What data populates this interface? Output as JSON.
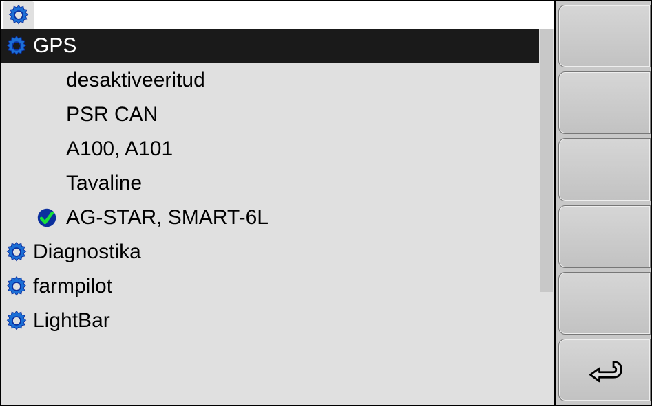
{
  "header": {
    "title": ""
  },
  "menu": {
    "items": [
      {
        "key": "gps",
        "label": "GPS",
        "has_gear": true,
        "selected": true
      },
      {
        "key": "diagnostika",
        "label": "Diagnostika",
        "has_gear": true,
        "selected": false
      },
      {
        "key": "farmpilot",
        "label": "farmpilot",
        "has_gear": true,
        "selected": false
      },
      {
        "key": "lightbar",
        "label": "LightBar",
        "has_gear": true,
        "selected": false
      }
    ]
  },
  "gps_options": [
    {
      "label": "desaktiveeritud",
      "checked": false
    },
    {
      "label": "PSR CAN",
      "checked": false
    },
    {
      "label": "A100, A101",
      "checked": false
    },
    {
      "label": "Tavaline",
      "checked": false
    },
    {
      "label": "AG-STAR, SMART-6L",
      "checked": true
    }
  ],
  "sidebar": {
    "buttons": [
      {
        "name": "side-btn-1",
        "icon": null
      },
      {
        "name": "side-btn-2",
        "icon": null
      },
      {
        "name": "side-btn-3",
        "icon": null
      },
      {
        "name": "side-btn-4",
        "icon": null
      },
      {
        "name": "side-btn-5",
        "icon": null
      },
      {
        "name": "side-btn-back",
        "icon": "back"
      }
    ]
  },
  "icons": {
    "gear": "gear-icon",
    "check": "check-icon",
    "back": "back-icon"
  },
  "colors": {
    "gear_blue": "#1b6fd6",
    "check_bg": "#0b2f9e",
    "check_mark": "#18e03a",
    "selected_bg": "#1a1a1a",
    "panel_bg": "#e0e0e0",
    "side_bg": "#c8c8c8"
  }
}
